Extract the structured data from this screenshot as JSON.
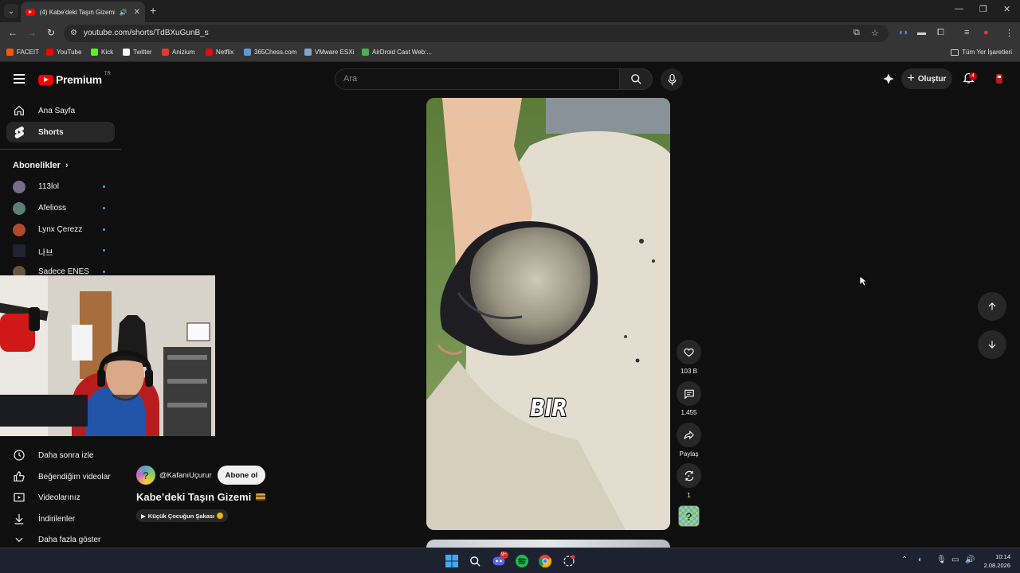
{
  "browser": {
    "tab_title": "(4) Kabe'deki Taşın Gizemi",
    "url": "youtube.com/shorts/TdBXuGunB_s",
    "bookmarks": [
      {
        "label": "FACEIT",
        "color": "#ff5500"
      },
      {
        "label": "YouTube",
        "color": "#ff0000"
      },
      {
        "label": "Kick",
        "color": "#53fc18"
      },
      {
        "label": "Twitter",
        "color": "#ffffff"
      },
      {
        "label": "Anizium",
        "color": "#e53935"
      },
      {
        "label": "Netflix",
        "color": "#e50914"
      },
      {
        "label": "365Chess.com",
        "color": "#5b9bd5"
      },
      {
        "label": "VMware ESXi",
        "color": "#7fa7c9"
      },
      {
        "label": "AirDroid Cast Web:...",
        "color": "#4caf50"
      }
    ],
    "all_bookmarks": "Tüm Yer İşaretleri"
  },
  "masthead": {
    "logo": "Premium",
    "country": "TR",
    "search_placeholder": "Ara",
    "create_label": "Oluştur",
    "notification_count": "4"
  },
  "sidebar": {
    "items": [
      {
        "label": "Ana Sayfa",
        "icon": "home-icon"
      },
      {
        "label": "Shorts",
        "icon": "shorts-icon"
      }
    ],
    "subscriptions_header": "Abonelikler",
    "subscriptions": [
      {
        "label": "113lol",
        "color": "#7a6a8c"
      },
      {
        "label": "Afelioss",
        "color": "#5c7d7a"
      },
      {
        "label": "Lynx Çerezz",
        "color": "#b04a2a"
      },
      {
        "label": "나브",
        "color": "#222233"
      },
      {
        "label": "Sadece ENES",
        "color": "#6a5540"
      }
    ],
    "bottom_items": [
      {
        "label": "Daha sonra izle",
        "icon": "clock-icon"
      },
      {
        "label": "Beğendiğim videolar",
        "icon": "thumbs-up-icon"
      },
      {
        "label": "Videolarınız",
        "icon": "play-square-icon"
      },
      {
        "label": "İndirilenler",
        "icon": "download-icon"
      },
      {
        "label": "Daha fazla göster",
        "icon": "chevron-down-icon"
      }
    ]
  },
  "short": {
    "channel": "@KafanıUçurur",
    "subscribe_label": "Abone ol",
    "title": "Kabe’deki Taşın Gizemi",
    "music": "Küçük Çocuğun Şakası",
    "caption": "BIR",
    "likes": "103 B",
    "comments": "1.455",
    "share_label": "Paylaş",
    "remix_count": "1"
  },
  "taskbar": {
    "time": "10:14",
    "date": "2.08.2026",
    "discord_badge": "9+"
  }
}
